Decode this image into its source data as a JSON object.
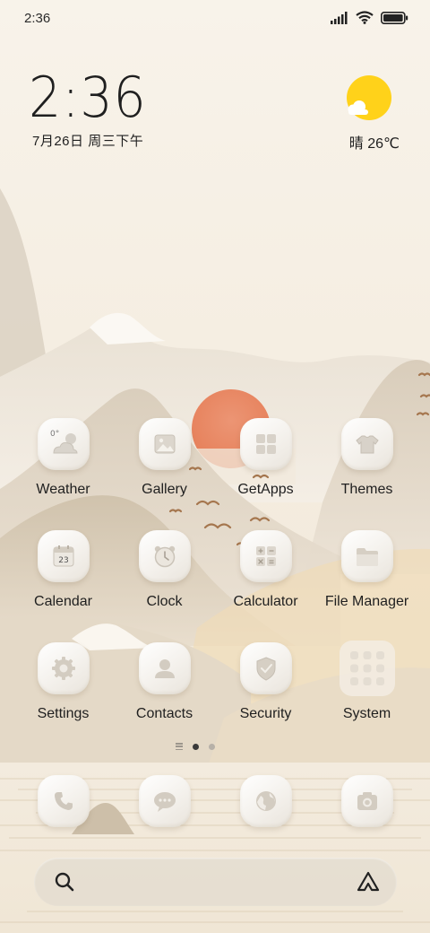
{
  "status_bar": {
    "time": "2:36",
    "icons": [
      "signal-icon",
      "wifi-icon",
      "battery-icon"
    ]
  },
  "clock_widget": {
    "time": "2:36",
    "date": "7月26日 周三下午"
  },
  "weather_widget": {
    "condition_temp": "晴 26℃",
    "icon": "sun-cloud-icon"
  },
  "apps": [
    {
      "label": "Weather",
      "icon": "weather-icon",
      "badge": "0°"
    },
    {
      "label": "Gallery",
      "icon": "gallery-icon"
    },
    {
      "label": "GetApps",
      "icon": "getapps-icon"
    },
    {
      "label": "Themes",
      "icon": "themes-icon"
    },
    {
      "label": "Calendar",
      "icon": "calendar-icon",
      "badge": "23"
    },
    {
      "label": "Clock",
      "icon": "clock-icon"
    },
    {
      "label": "Calculator",
      "icon": "calculator-icon"
    },
    {
      "label": "File Manager",
      "icon": "folder-icon"
    },
    {
      "label": "Settings",
      "icon": "settings-icon"
    },
    {
      "label": "Contacts",
      "icon": "contacts-icon"
    },
    {
      "label": "Security",
      "icon": "security-icon"
    },
    {
      "label": "System",
      "icon": "system-folder-icon"
    }
  ],
  "page_indicator": {
    "pages": 2,
    "current": 1
  },
  "dock": [
    {
      "icon": "phone-icon"
    },
    {
      "icon": "messages-icon"
    },
    {
      "icon": "browser-icon"
    },
    {
      "icon": "camera-icon"
    }
  ],
  "search_bar": {
    "left_icon": "search-icon",
    "right_icon": "assistant-icon"
  },
  "colors": {
    "accent_sun": "#ffd21a",
    "wallpaper_sun": "#e9845e",
    "text": "#1f1f1f"
  }
}
